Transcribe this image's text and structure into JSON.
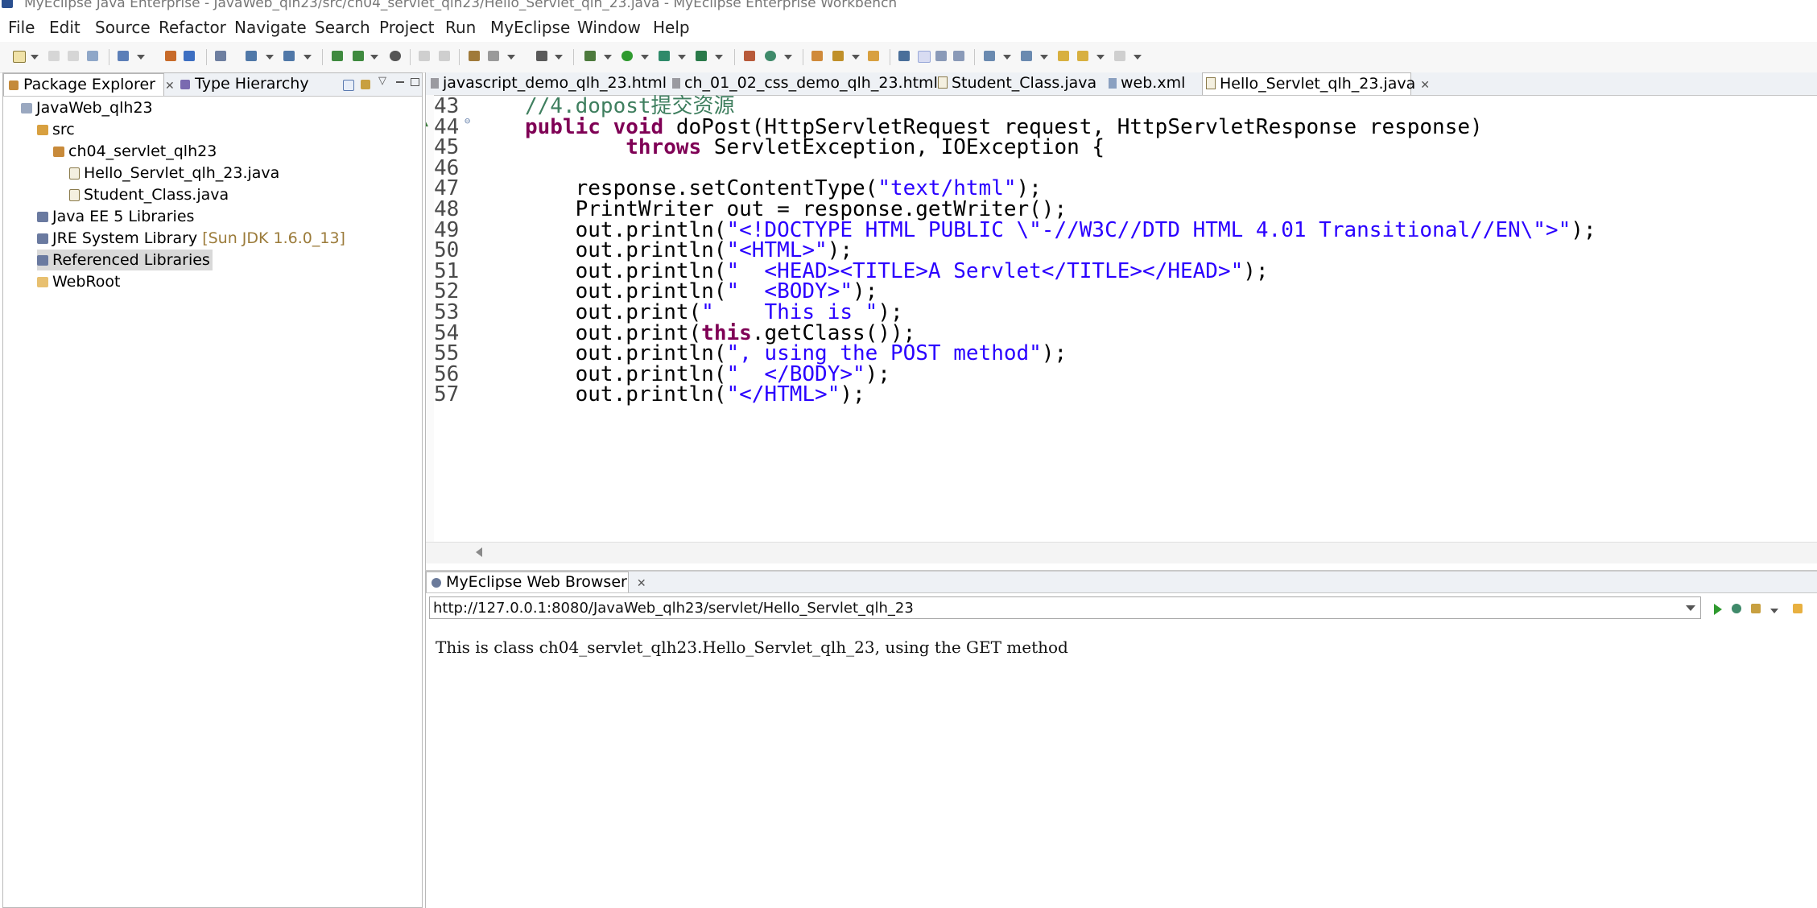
{
  "window": {
    "title": "MyEclipse Java Enterprise - JavaWeb_qlh23/src/ch04_servlet_qlh23/Hello_Servlet_qlh_23.java - MyEclipse Enterprise Workbench"
  },
  "menu": [
    "File",
    "Edit",
    "Source",
    "Refactor",
    "Navigate",
    "Search",
    "Project",
    "Run",
    "MyEclipse",
    "Window",
    "Help"
  ],
  "left_panel": {
    "tabs": [
      "Package Explorer",
      "Type Hierarchy"
    ],
    "tree": {
      "project": "JavaWeb_qlh23",
      "src": "src",
      "package": "ch04_servlet_qlh23",
      "file1": "Hello_Servlet_qlh_23.java",
      "file2": "Student_Class.java",
      "javaee_lib": "Java EE 5 Libraries",
      "jre_lib": "JRE System Library",
      "jre_lib_hint": "[Sun JDK 1.6.0_13]",
      "ref_libs": "Referenced Libraries",
      "webroot": "WebRoot"
    }
  },
  "editor": {
    "tabs": [
      "javascript_demo_qlh_23.html",
      "ch_01_02_css_demo_qlh_23.html",
      "Student_Class.java",
      "web.xml",
      "Hello_Servlet_qlh_23.java"
    ],
    "active_tab": "Hello_Servlet_qlh_23.java",
    "lines": [
      {
        "num": "43",
        "indent": "",
        "parts": [
          {
            "t": "cm",
            "s": "//4.dopost提交资源"
          }
        ]
      },
      {
        "num": "44",
        "indent": "",
        "parts": [
          {
            "t": "kw",
            "s": "public"
          },
          {
            "t": "p",
            "s": " "
          },
          {
            "t": "kw",
            "s": "void"
          },
          {
            "t": "p",
            "s": " doPost(HttpServletRequest request, HttpServletResponse response)"
          }
        ]
      },
      {
        "num": "45",
        "indent": "        ",
        "parts": [
          {
            "t": "kw",
            "s": "throws"
          },
          {
            "t": "p",
            "s": " ServletException, IOException {"
          }
        ]
      },
      {
        "num": "46",
        "indent": "",
        "parts": []
      },
      {
        "num": "47",
        "indent": "    ",
        "parts": [
          {
            "t": "p",
            "s": "response.setContentType("
          },
          {
            "t": "str",
            "s": "\"text/html\""
          },
          {
            "t": "p",
            "s": ");"
          }
        ]
      },
      {
        "num": "48",
        "indent": "    ",
        "parts": [
          {
            "t": "p",
            "s": "PrintWriter out = response.getWriter();"
          }
        ]
      },
      {
        "num": "49",
        "indent": "    ",
        "parts": [
          {
            "t": "p",
            "s": "out.println("
          },
          {
            "t": "str",
            "s": "\"<!DOCTYPE HTML PUBLIC \\\"-//W3C//DTD HTML 4.01 Transitional//EN\\\">\""
          },
          {
            "t": "p",
            "s": ");"
          }
        ]
      },
      {
        "num": "50",
        "indent": "    ",
        "parts": [
          {
            "t": "p",
            "s": "out.println("
          },
          {
            "t": "str",
            "s": "\"<HTML>\""
          },
          {
            "t": "p",
            "s": ");"
          }
        ]
      },
      {
        "num": "51",
        "indent": "    ",
        "parts": [
          {
            "t": "p",
            "s": "out.println("
          },
          {
            "t": "str",
            "s": "\"  <HEAD><TITLE>A Servlet</TITLE></HEAD>\""
          },
          {
            "t": "p",
            "s": ");"
          }
        ]
      },
      {
        "num": "52",
        "indent": "    ",
        "parts": [
          {
            "t": "p",
            "s": "out.println("
          },
          {
            "t": "str",
            "s": "\"  <BODY>\""
          },
          {
            "t": "p",
            "s": ");"
          }
        ]
      },
      {
        "num": "53",
        "indent": "    ",
        "parts": [
          {
            "t": "p",
            "s": "out.print("
          },
          {
            "t": "str",
            "s": "\"    This is \""
          },
          {
            "t": "p",
            "s": ");"
          }
        ]
      },
      {
        "num": "54",
        "indent": "    ",
        "parts": [
          {
            "t": "p",
            "s": "out.print("
          },
          {
            "t": "kw",
            "s": "this"
          },
          {
            "t": "p",
            "s": ".getClass());"
          }
        ]
      },
      {
        "num": "55",
        "indent": "    ",
        "parts": [
          {
            "t": "p",
            "s": "out.println("
          },
          {
            "t": "str",
            "s": "\", using the POST method\""
          },
          {
            "t": "p",
            "s": ");"
          }
        ]
      },
      {
        "num": "56",
        "indent": "    ",
        "parts": [
          {
            "t": "p",
            "s": "out.println("
          },
          {
            "t": "str",
            "s": "\"  </BODY>\""
          },
          {
            "t": "p",
            "s": ");"
          }
        ]
      },
      {
        "num": "57",
        "indent": "    ",
        "parts": [
          {
            "t": "p",
            "s": "out.println("
          },
          {
            "t": "str",
            "s": "\"</HTML>\""
          },
          {
            "t": "p",
            "s": ");"
          }
        ]
      }
    ]
  },
  "browser": {
    "tab": "MyEclipse Web Browser",
    "url": "http://127.0.0.1:8080/JavaWeb_qlh23/servlet/Hello_Servlet_qlh_23",
    "content": "This is class ch04_servlet_qlh23.Hello_Servlet_qlh_23, using the GET method"
  },
  "colors": {
    "keyword": "#7f0055",
    "string": "#2a00ff",
    "comment": "#3f7f5f",
    "tab_bar": "#eef1f5",
    "lib_hint": "#9b7b3a"
  }
}
